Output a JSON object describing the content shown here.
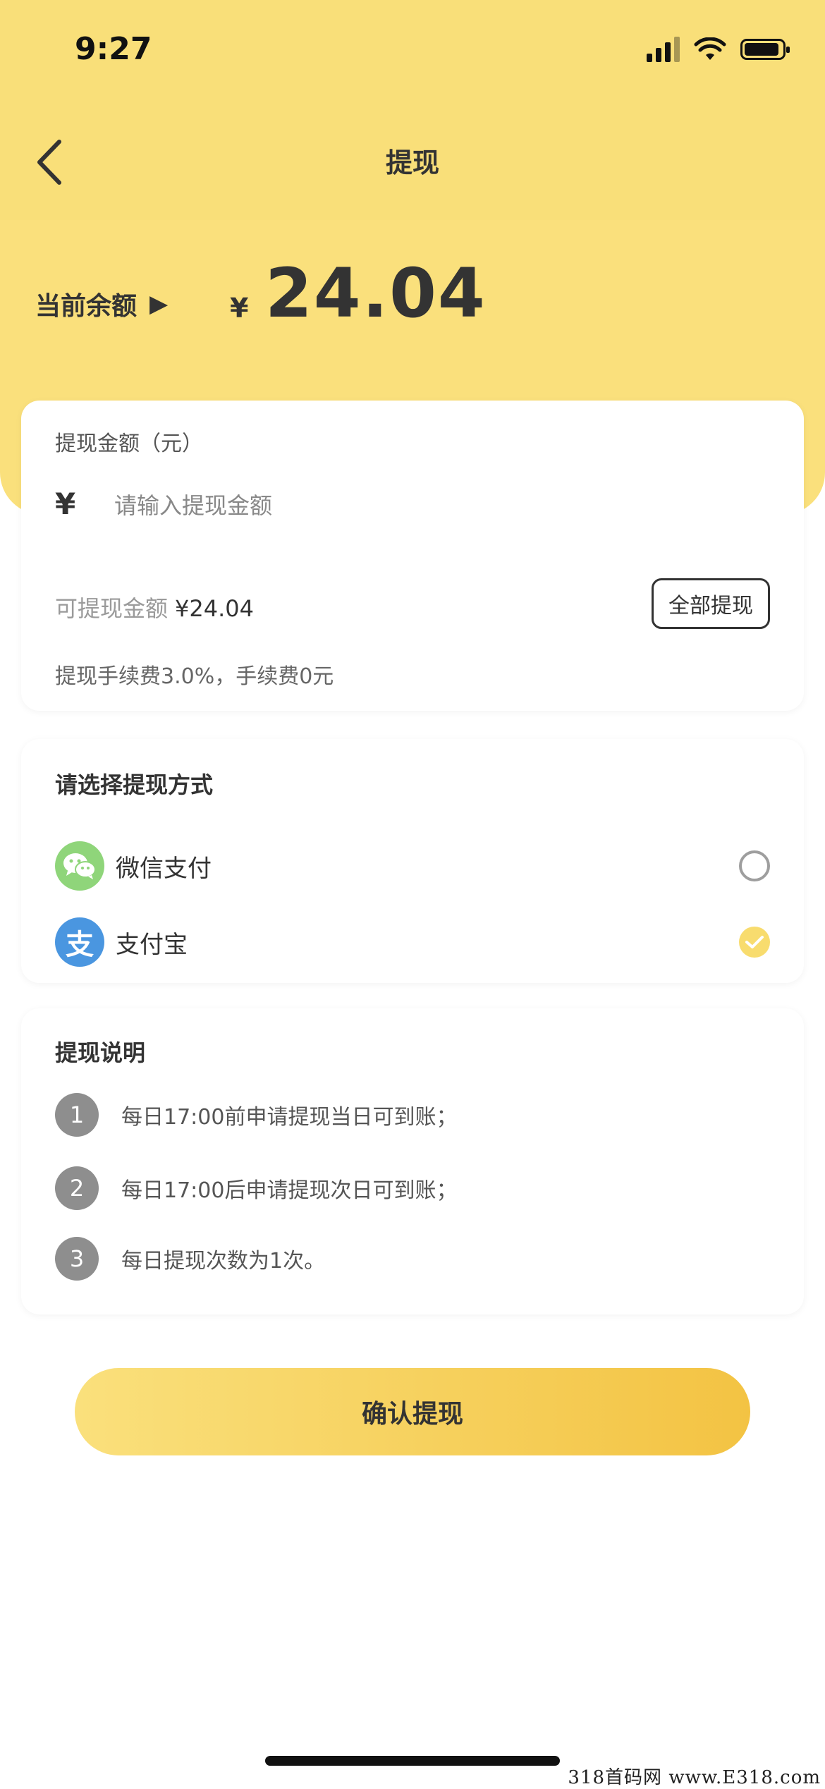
{
  "status_bar": {
    "time": "9:27"
  },
  "nav": {
    "title": "提现"
  },
  "balance": {
    "label": "当前余额",
    "arrow": "▶",
    "currency": "¥",
    "amount": "24.04"
  },
  "amount_card": {
    "label": "提现金额（元）",
    "currency": "¥",
    "input_placeholder": "请输入提现金额",
    "available_label": "可提现金额",
    "available_value": "¥24.04",
    "withdraw_all_label": "全部提现",
    "fee_text": "提现手续费3.0%，手续费0元"
  },
  "method_card": {
    "title": "请选择提现方式",
    "methods": [
      {
        "label": "微信支付",
        "icon": "wechat-icon",
        "selected": false
      },
      {
        "label": "支付宝",
        "icon": "alipay-icon",
        "icon_glyph": "支",
        "selected": true
      }
    ]
  },
  "notes_card": {
    "title": "提现说明",
    "items": [
      {
        "num": "1",
        "text": "每日17:00前申请提现当日可到账；"
      },
      {
        "num": "2",
        "text": "每日17:00后申请提现次日可到账；"
      },
      {
        "num": "3",
        "text": "每日提现次数为1次。"
      }
    ]
  },
  "confirm_button": {
    "label": "确认提现"
  },
  "watermark": {
    "text": "318首码网 www.E318.com"
  },
  "colors": {
    "brand_yellow": "#fae07c",
    "button_gradient_end": "#f3c343",
    "wechat_green": "#8fd57a",
    "alipay_blue": "#4a96e0"
  }
}
